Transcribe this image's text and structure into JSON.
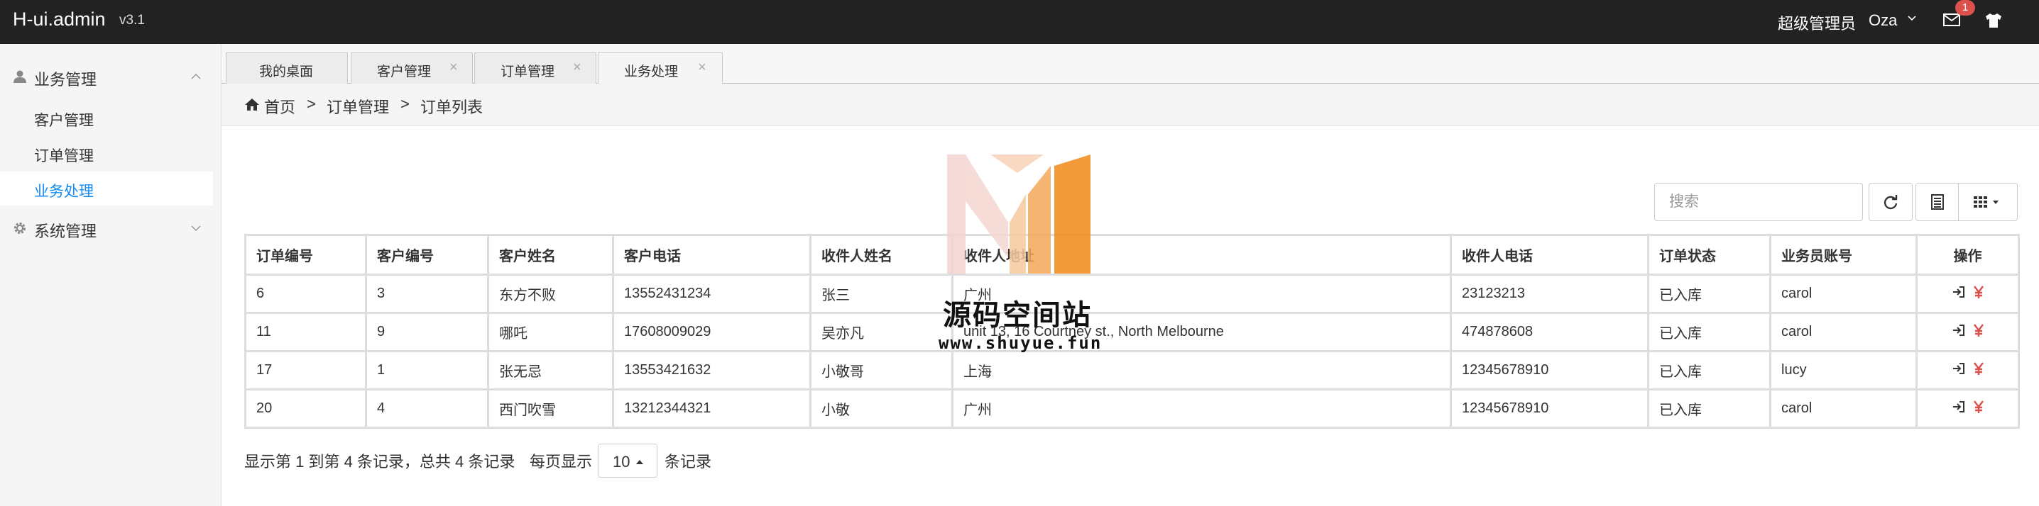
{
  "header": {
    "brand": "H-ui.admin",
    "version": "v3.1",
    "role": "超级管理员",
    "user": "Oza",
    "mail_badge": "1",
    "icons": [
      "chevron-down-icon",
      "mail-icon",
      "shirt-icon"
    ]
  },
  "sidebar": {
    "groups": [
      {
        "label": "业务管理",
        "icon": "user-icon",
        "expanded": true,
        "items": [
          {
            "label": "客户管理",
            "active": false
          },
          {
            "label": "订单管理",
            "active": false
          },
          {
            "label": "业务处理",
            "active": true
          }
        ]
      },
      {
        "label": "系统管理",
        "icon": "gear-icon",
        "expanded": false,
        "items": []
      }
    ]
  },
  "tabs": [
    {
      "label": "我的桌面",
      "closable": false,
      "active": false
    },
    {
      "label": "客户管理",
      "closable": true,
      "active": false
    },
    {
      "label": "订单管理",
      "closable": true,
      "active": false
    },
    {
      "label": "业务处理",
      "closable": true,
      "active": true
    }
  ],
  "breadcrumb": {
    "home": "首页",
    "sep": ">",
    "items": [
      "订单管理",
      "订单列表"
    ]
  },
  "toolbar": {
    "search_placeholder": "搜索",
    "buttons": [
      "refresh-icon",
      "toggle-view-icon",
      "columns-icon"
    ]
  },
  "table": {
    "headers": [
      "订单编号",
      "客户编号",
      "客户姓名",
      "客户电话",
      "收件人姓名",
      "收件人地址",
      "收件人电话",
      "订单状态",
      "业务员账号",
      "操作"
    ],
    "rows": [
      [
        "6",
        "3",
        "东方不败",
        "13552431234",
        "张三",
        "广州",
        "23123213",
        "已入库",
        "carol"
      ],
      [
        "11",
        "9",
        "哪吒",
        "17608009029",
        "吴亦凡",
        "unit 13, 16 Courtney st., North Melbourne",
        "474878608",
        "已入库",
        "carol"
      ],
      [
        "17",
        "1",
        "张无忌",
        "13553421632",
        "小敬哥",
        "上海",
        "12345678910",
        "已入库",
        "lucy"
      ],
      [
        "20",
        "4",
        "西门吹雪",
        "13212344321",
        "小敬",
        "广州",
        "12345678910",
        "已入库",
        "carol"
      ]
    ],
    "row_actions": [
      "sign-in-icon",
      "yen-icon"
    ]
  },
  "pagination": {
    "info": "显示第 1 到第 4 条记录，总共 4 条记录",
    "per_page_label": "每页显示",
    "per_page_value": "10",
    "unit": "条记录"
  },
  "watermark": {
    "title": "源码空间站",
    "url": "www.shuyue.fun"
  },
  "colors": {
    "header_bg": "#222222",
    "active_link": "#148cf1",
    "action_icon": "#dd514c"
  }
}
